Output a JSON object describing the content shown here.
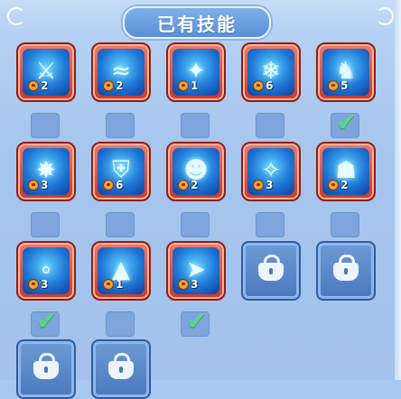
{
  "title": "已有技能",
  "skills": [
    {
      "icon": "ice-slash-icon",
      "count": "2",
      "selected": false
    },
    {
      "icon": "water-whip-icon",
      "count": "2",
      "selected": false
    },
    {
      "icon": "crystal-strike-icon",
      "count": "1",
      "selected": false
    },
    {
      "icon": "frost-beast-icon",
      "count": "6",
      "selected": false
    },
    {
      "icon": "tiger-roar-icon",
      "count": "5",
      "selected": true
    },
    {
      "icon": "ice-golem-icon",
      "count": "3",
      "selected": false
    },
    {
      "icon": "shield-icon",
      "count": "6",
      "selected": false
    },
    {
      "icon": "monkey-beast-icon",
      "count": "2",
      "selected": false
    },
    {
      "icon": "purple-claw-icon",
      "count": "3",
      "selected": false
    },
    {
      "icon": "frog-golem-icon",
      "count": "2",
      "selected": false
    },
    {
      "icon": "bubble-icon",
      "count": "3",
      "selected": true
    },
    {
      "icon": "iron-fist-icon",
      "count": "1",
      "selected": false
    },
    {
      "icon": "dash-runner-icon",
      "count": "3",
      "selected": true
    }
  ],
  "locked_slots": 4,
  "colors": {
    "background": "#a9c8ef",
    "slot_frame": "#c93a2d",
    "locked_slot": "#4a78bd",
    "check": "#5fd38e"
  }
}
